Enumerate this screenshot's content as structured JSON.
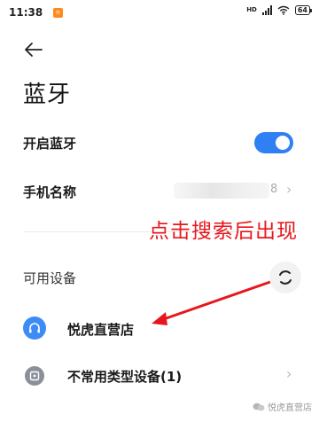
{
  "status_bar": {
    "time": "11:38",
    "network": "HD",
    "battery": "64",
    "icons": [
      "notification-app-icon",
      "signal-icon",
      "wifi-icon",
      "battery-icon"
    ]
  },
  "header": {
    "back_icon": "arrow-left-icon",
    "title": "蓝牙"
  },
  "settings": {
    "bluetooth_toggle": {
      "label": "开启蓝牙",
      "state": "on",
      "color": "#2f7ff5"
    },
    "device_name": {
      "label": "手机名称",
      "value_suffix": "8"
    }
  },
  "available": {
    "section_label": "可用设备",
    "refresh_icon": "refresh-spinner-icon",
    "devices": [
      {
        "name": "悦虎直营店",
        "icon": "headphones-icon",
        "icon_color": "#3d8bf6"
      }
    ]
  },
  "uncommon": {
    "label": "不常用类型设备(1)",
    "icon": "device-square-icon"
  },
  "annotation": {
    "text": "点击搜索后出现",
    "color": "#e8161c"
  },
  "watermark": {
    "text": "悦虎直营店"
  }
}
